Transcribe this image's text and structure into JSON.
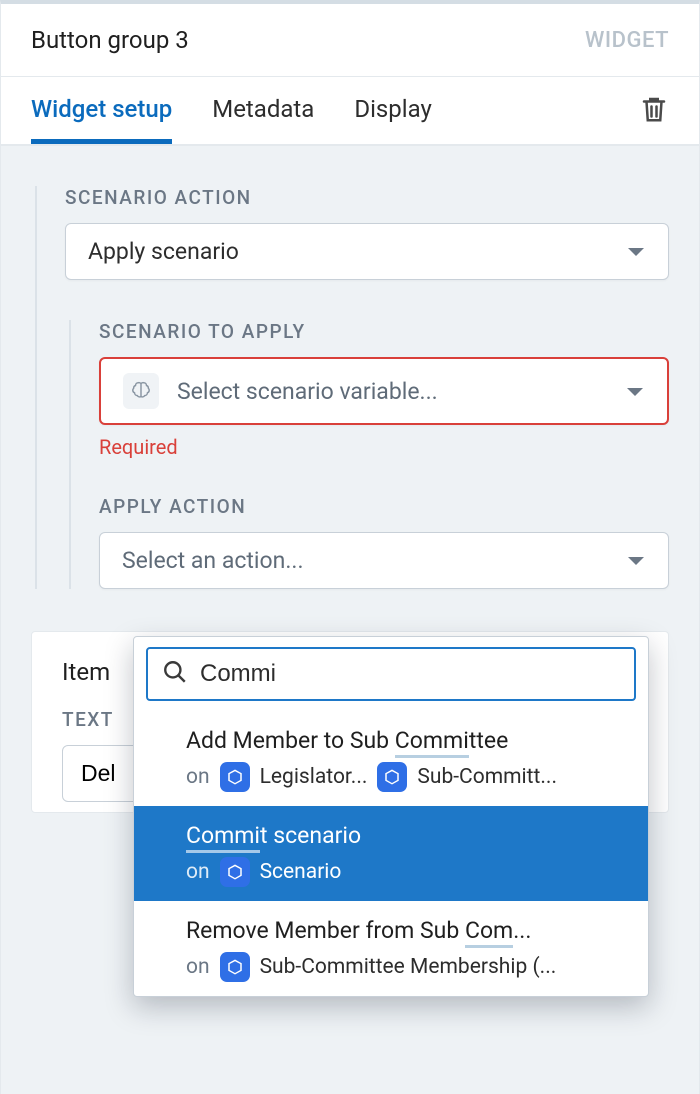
{
  "header": {
    "title": "Button group 3",
    "badge": "WIDGET"
  },
  "tabs": {
    "setup": "Widget setup",
    "metadata": "Metadata",
    "display": "Display"
  },
  "scenario_action": {
    "label": "SCENARIO ACTION",
    "value": "Apply scenario"
  },
  "scenario_to_apply": {
    "label": "SCENARIO TO APPLY",
    "placeholder": "Select scenario variable...",
    "error": "Required"
  },
  "apply_action": {
    "label": "APPLY ACTION",
    "placeholder": "Select an action..."
  },
  "dropdown": {
    "search_value": "Commi",
    "options": [
      {
        "title_pre": "Add Member to Sub ",
        "title_highlight": "Commi",
        "title_post": "ttee",
        "on": "on",
        "entities": [
          "Legislator...",
          "Sub-Committ..."
        ]
      },
      {
        "title_pre": "",
        "title_highlight": "Commi",
        "title_post": "t scenario",
        "on": "on",
        "entities": [
          "Scenario"
        ]
      },
      {
        "title_pre": "Remove Member from Sub ",
        "title_highlight": "Com",
        "title_post": "...",
        "on": "on",
        "entities": [
          "Sub-Committee Membership (..."
        ]
      }
    ]
  },
  "item_card": {
    "title_prefix": "Item",
    "text_label": "TEXT",
    "text_value": "Del"
  },
  "icons": {
    "trash": "trash-icon",
    "brain": "brain-icon",
    "caret": "caret-down-icon",
    "search": "search-icon",
    "cube": "cube-icon"
  }
}
